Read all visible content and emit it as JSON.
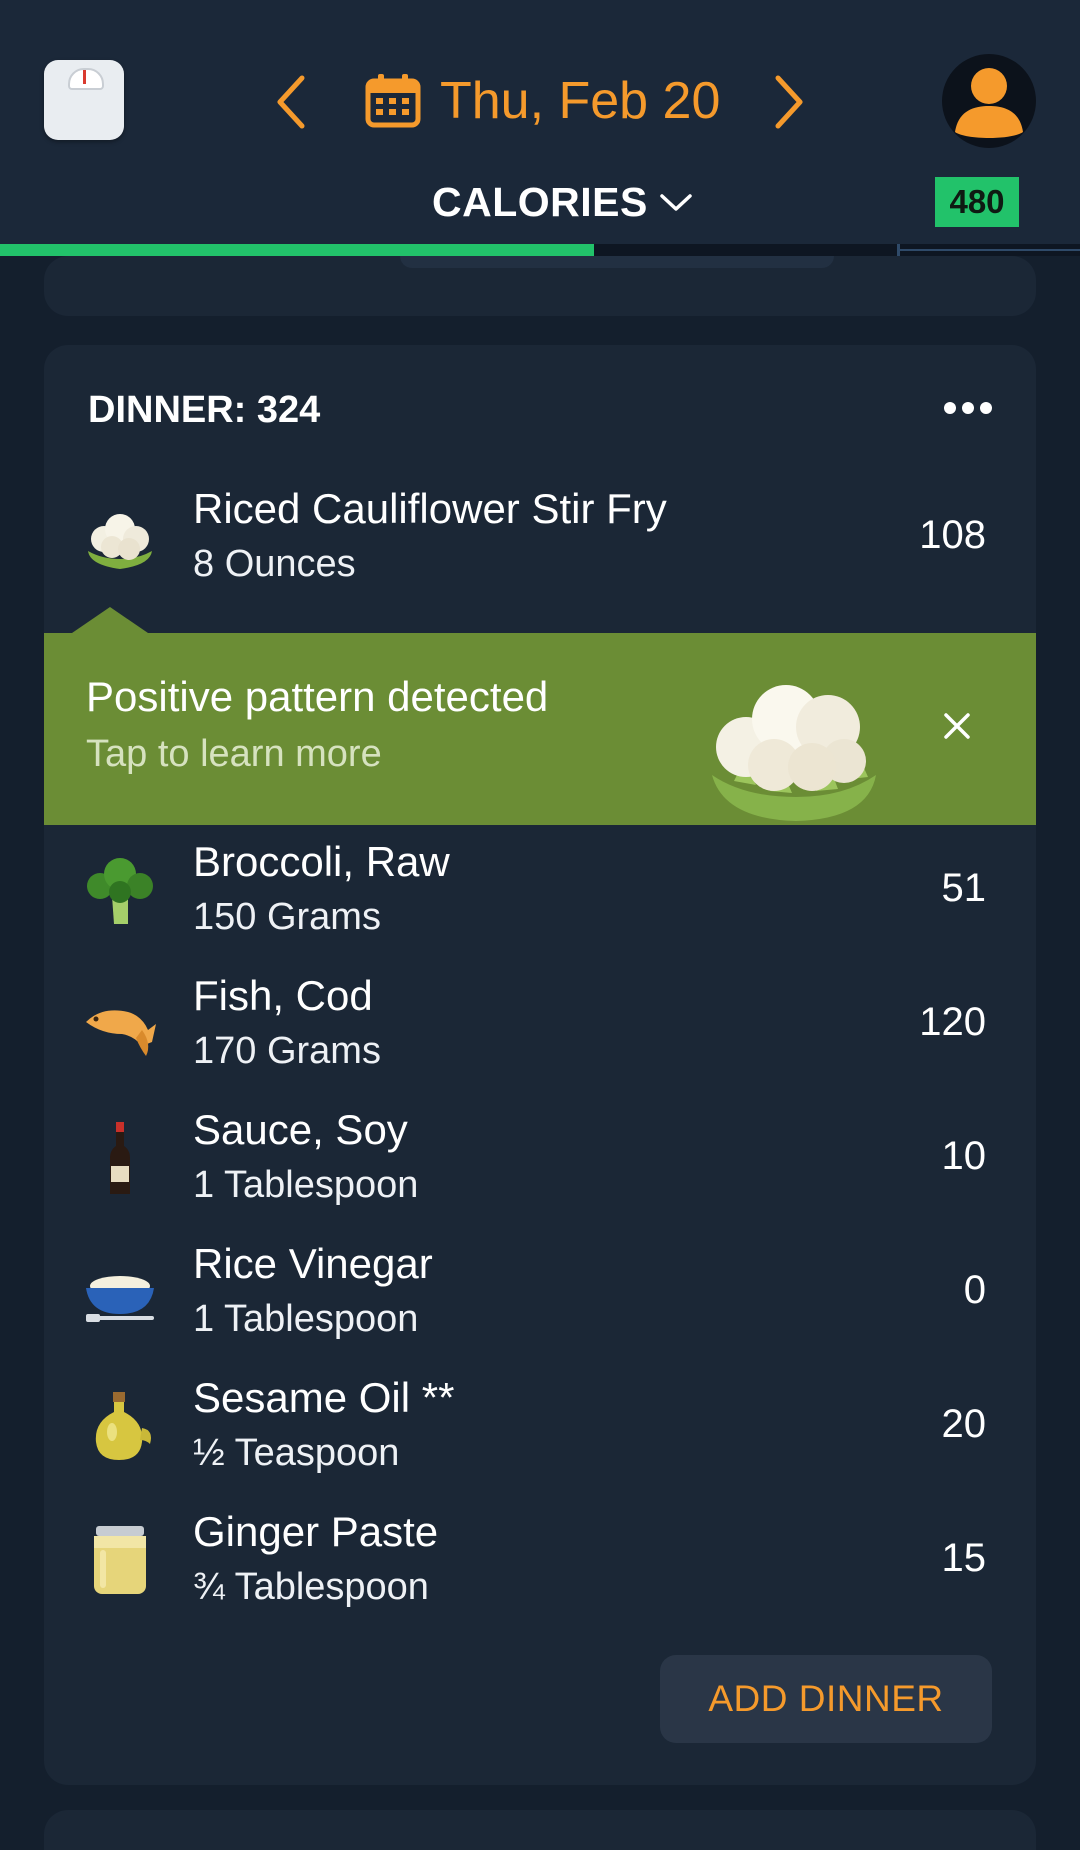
{
  "header": {
    "date": "Thu, Feb 20",
    "metric_label": "CALORIES",
    "remaining_calories": "480",
    "progress_fraction": 0.55
  },
  "dinner": {
    "title": "DINNER: 324",
    "items": [
      {
        "name": "Riced Cauliflower Stir Fry",
        "amount": "8 Ounces",
        "calories": "108",
        "icon": "cauliflower-icon"
      },
      {
        "name": "Broccoli, Raw",
        "amount": "150 Grams",
        "calories": "51",
        "icon": "broccoli-icon"
      },
      {
        "name": "Fish, Cod",
        "amount": "170 Grams",
        "calories": "120",
        "icon": "fish-icon"
      },
      {
        "name": "Sauce, Soy",
        "amount": "1 Tablespoon",
        "calories": "10",
        "icon": "soy-sauce-bottle-icon"
      },
      {
        "name": "Rice Vinegar",
        "amount": "1 Tablespoon",
        "calories": "0",
        "icon": "rice-bowl-icon"
      },
      {
        "name": "Sesame Oil **",
        "amount": "½ Teaspoon",
        "calories": "20",
        "icon": "oil-bottle-icon"
      },
      {
        "name": "Ginger Paste",
        "amount": "¾ Tablespoon",
        "calories": "15",
        "icon": "jar-icon"
      }
    ],
    "add_button_label": "ADD DINNER"
  },
  "pattern_banner": {
    "title": "Positive pattern detected",
    "subtitle": "Tap to learn more",
    "icon": "cauliflower-icon"
  },
  "colors": {
    "accent_orange": "#f59a2c",
    "progress_green": "#22c26a",
    "banner_green": "#6b8d35",
    "background": "#141f2d",
    "card": "#1b2736"
  }
}
